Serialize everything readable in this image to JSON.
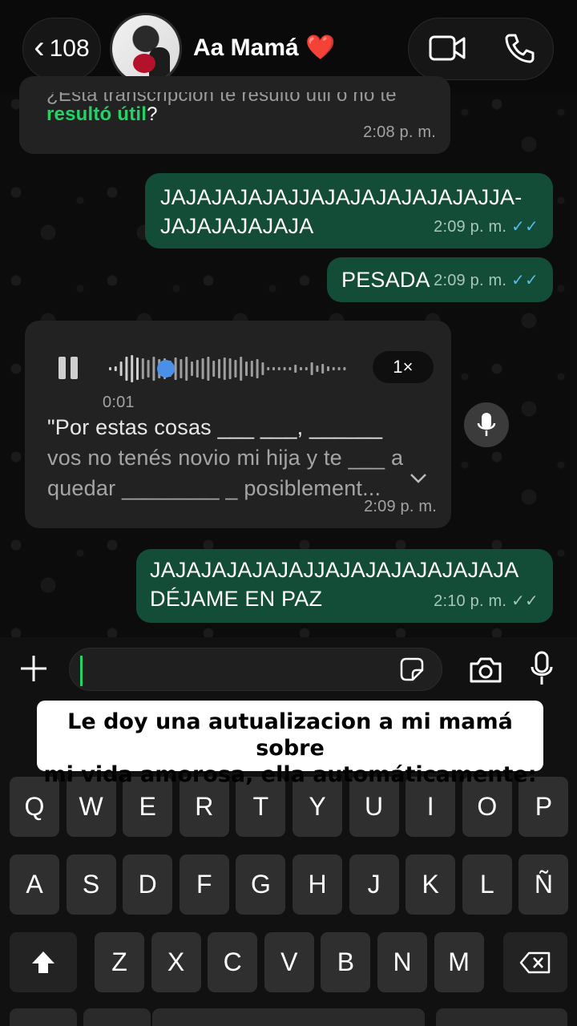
{
  "header": {
    "back_count": "108",
    "contact_name": "Aa Mamá",
    "heart": "❤️"
  },
  "messages": [
    {
      "direction": "in",
      "partial_text": "¿Esta transcripción te resultó útil o no te",
      "link_text": "resultó útil",
      "suffix": "?",
      "time": "2:08 p. m."
    },
    {
      "direction": "out",
      "text_line1": "JAJAJAJAJAJJAJAJAJAJAJAJAJJA-",
      "text_line2": "JAJAJAJAJAJA",
      "time": "2:09 p. m.",
      "ticks": "✓✓"
    },
    {
      "direction": "out",
      "text": "PESADA",
      "time": "2:09 p. m.",
      "ticks": "✓✓"
    },
    {
      "direction": "in",
      "type": "voice",
      "elapsed": "0:01",
      "speed": "1×",
      "transcript_line1": "\"Por estas cosas ___ ___, ______",
      "transcript_line2": "vos no tenés novio mi hija y te ___ a",
      "transcript_line3": "quedar ________ _ posiblement...",
      "time": "2:09 p. m."
    },
    {
      "direction": "out",
      "text_line1": "JAJAJAJAJAJAJJAJAJAJAJAJAJAJA",
      "text_line2": "DÉJAME EN PAZ",
      "time": "2:10 p. m.",
      "ticks": "✓✓"
    }
  ],
  "caption": {
    "line1": "Le doy una autualizacion a mi mamá  sobre",
    "line2": "mi vida amorosa, ella automáticamente:"
  },
  "keyboard": {
    "row1": [
      "Q",
      "W",
      "E",
      "R",
      "T",
      "Y",
      "U",
      "I",
      "O",
      "P"
    ],
    "row2": [
      "A",
      "S",
      "D",
      "F",
      "G",
      "H",
      "J",
      "K",
      "L",
      "Ñ"
    ],
    "row3": [
      "Z",
      "X",
      "C",
      "V",
      "B",
      "N",
      "M"
    ]
  },
  "colors": {
    "outgoing_bubble": "#134d37",
    "incoming_bubble": "#222222",
    "accent_green": "#24d366",
    "read_tick": "#53bdeb"
  }
}
